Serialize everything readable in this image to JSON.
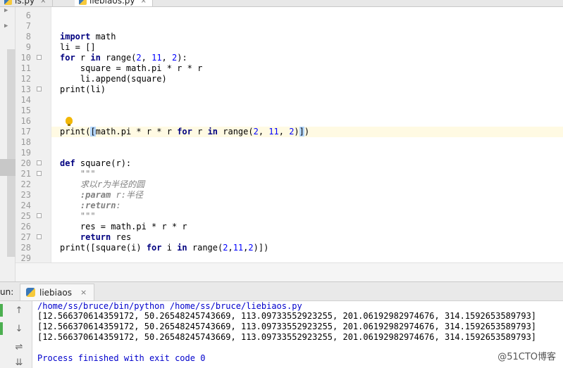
{
  "tabs": [
    {
      "label": "is.py",
      "active": false
    },
    {
      "label": "liebiaos.py",
      "active": true
    }
  ],
  "gutter_numbers": [
    "6",
    "7",
    "8",
    "9",
    "10",
    "11",
    "12",
    "13",
    "14",
    "15",
    "16",
    "17",
    "18",
    "19",
    "20",
    "21",
    "22",
    "23",
    "24",
    "25",
    "26",
    "27",
    "28",
    "29"
  ],
  "run_panel": {
    "label": "un:",
    "tab_label": "liebiaos",
    "console": {
      "command": "/home/ss/bruce/bin/python /home/ss/bruce/liebiaos.py",
      "output_lines": [
        "[12.566370614359172, 50.26548245743669, 113.09733552923255, 201.06192982974676, 314.1592653589793]",
        "[12.566370614359172, 50.26548245743669, 113.09733552923255, 201.06192982974676, 314.1592653589793]",
        "[12.566370614359172, 50.26548245743669, 113.09733552923255, 201.06192982974676, 314.1592653589793]"
      ],
      "exit_message": "Process finished with exit code 0"
    }
  },
  "watermark": "@51CTO博客",
  "icons": {
    "python_file": "python-file-icon",
    "intention": "lightbulb-icon",
    "rerun": "rerun-icon",
    "scroll_up": "arrow-up-icon",
    "scroll_down": "arrow-down-icon",
    "soft_wrap": "soft-wrap-icon",
    "scroll_end": "scroll-to-end-icon"
  },
  "colors": {
    "keyword": "#000080",
    "number": "#0000ff",
    "docstring": "#808080",
    "caret_row": "#fffae3",
    "console_path": "#0000cc"
  }
}
